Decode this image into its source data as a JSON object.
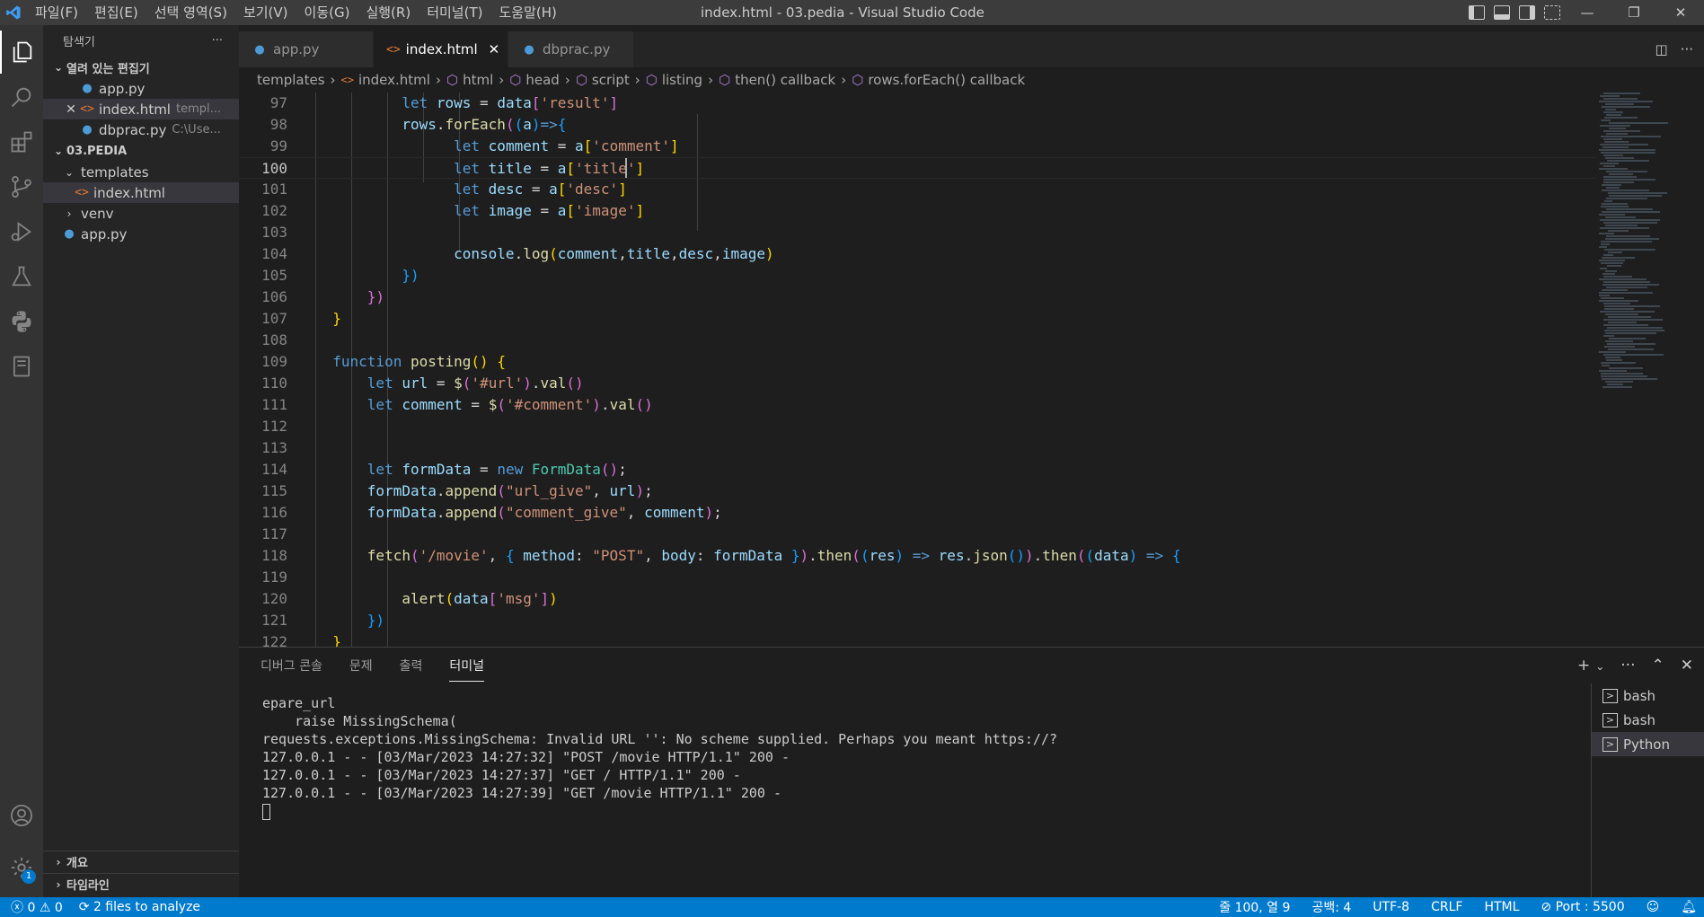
{
  "window": {
    "title": "index.html - 03.pedia - Visual Studio Code",
    "menus": [
      "파일(F)",
      "편집(E)",
      "선택 영역(S)",
      "보기(V)",
      "이동(G)",
      "실행(R)",
      "터미널(T)",
      "도움말(H)"
    ]
  },
  "sidebar": {
    "title": "탐색기",
    "more": "···",
    "open_editors_label": "열려 있는 편집기",
    "open_editors": [
      {
        "name": "app.py",
        "path": ""
      },
      {
        "name": "index.html",
        "path": "templ..."
      },
      {
        "name": "dbprac.py",
        "path": "C:\\Use..."
      }
    ],
    "folder_label": "03.PEDIA",
    "tree": {
      "templates": "templates",
      "index": "index.html",
      "venv": "venv",
      "app": "app.py"
    },
    "outline_label": "개요",
    "timeline_label": "타임라인"
  },
  "tabs": [
    {
      "label": "app.py"
    },
    {
      "label": "index.html"
    },
    {
      "label": "dbprac.py"
    }
  ],
  "breadcrumb": [
    "templates",
    "index.html",
    "html",
    "head",
    "script",
    "listing",
    "then() callback",
    "rows.forEach() callback"
  ],
  "editor": {
    "line_numbers": [
      "97",
      "98",
      "99",
      "100",
      "101",
      "102",
      "103",
      "104",
      "105",
      "106",
      "107",
      "108",
      "109",
      "110",
      "111",
      "112",
      "113",
      "114",
      "115",
      "116",
      "117",
      "118",
      "119",
      "120",
      "121",
      "122"
    ],
    "current_line": "100"
  },
  "panel": {
    "tabs": [
      "디버그 콘솔",
      "문제",
      "출력",
      "터미널"
    ],
    "terminal_lines": [
      "epare_url",
      "    raise MissingSchema(",
      "requests.exceptions.MissingSchema: Invalid URL '': No scheme supplied. Perhaps you meant https://?",
      "127.0.0.1 - - [03/Mar/2023 14:27:32] \"POST /movie HTTP/1.1\" 200 -",
      "127.0.0.1 - - [03/Mar/2023 14:27:37] \"GET / HTTP/1.1\" 200 -",
      "127.0.0.1 - - [03/Mar/2023 14:27:39] \"GET /movie HTTP/1.1\" 200 -"
    ],
    "terminals": [
      "bash",
      "bash",
      "Python"
    ]
  },
  "statusbar": {
    "errors": "0",
    "warnings": "0",
    "analyze": "2 files to analyze",
    "position": "줄 100, 열 9",
    "spaces": "공백: 4",
    "encoding": "UTF-8",
    "eol": "CRLF",
    "language": "HTML",
    "port": "Port : 5500"
  },
  "badges": {
    "settings": "1"
  },
  "colors": {
    "accent": "#007acc",
    "keyword": "#569cd6",
    "string": "#ce9178",
    "function": "#dcdcaa",
    "variable": "#9cdcfe"
  }
}
